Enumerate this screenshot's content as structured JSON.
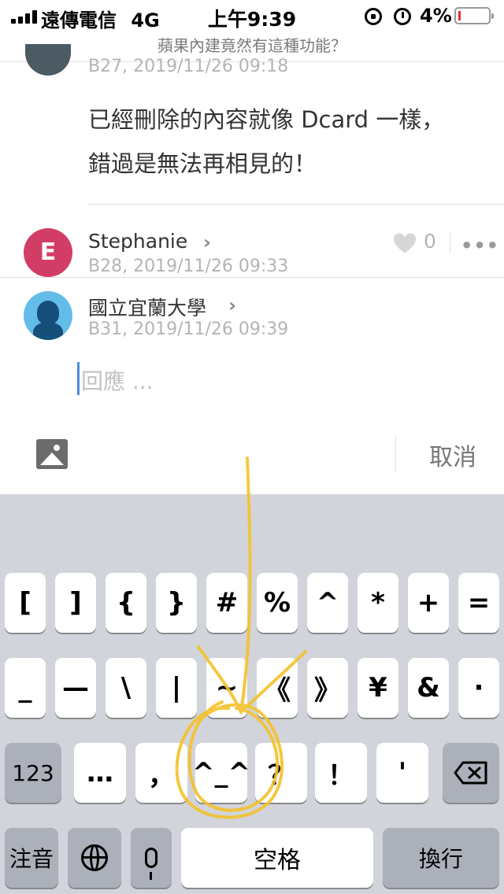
{
  "status_bar": {
    "carrier": "遠傳電信",
    "network": "4G",
    "time": "上午9:39",
    "battery": "4%",
    "icons": [
      "signal-icon",
      "rotation-lock-icon",
      "alarm-icon",
      "battery-icon"
    ]
  },
  "header": {
    "title": "蘋果內建竟然有這種功能？"
  },
  "comments": [
    {
      "meta": "B27, 2019/11/26 09:18",
      "text_lines": [
        "已經刪除的內容就像 Dcard 一樣，",
        "錯過是無法再相見的！"
      ]
    },
    {
      "author": "Stephanie",
      "avatar_letter": "E",
      "meta": "B28, 2019/11/26 09:33",
      "likes": "0"
    }
  ],
  "reply": {
    "author": "國立宜蘭大學",
    "meta": "B31, 2019/11/26 09:39",
    "placeholder": "回應 ...",
    "cancel_label": "取消"
  },
  "keyboard": {
    "row1": [
      "[",
      "]",
      "{",
      "}",
      "#",
      "%",
      "^",
      "*",
      "+",
      "="
    ],
    "row2": [
      "_",
      "—",
      "\\",
      "|",
      "~",
      "《",
      "》",
      "¥",
      "&",
      "·"
    ],
    "row3_mode": "123",
    "row3": [
      "…",
      "，",
      "^_^",
      "？",
      "！",
      "'"
    ],
    "bottom": {
      "zhuyin": "注音",
      "space": "空格",
      "return": "換行"
    }
  },
  "colors": {
    "avatar_letter_bg": "#d23d66",
    "avatar_school_bg": "#64bce9",
    "keyboard_bg": "#d1d4da",
    "annotation": "#f4c22b"
  }
}
